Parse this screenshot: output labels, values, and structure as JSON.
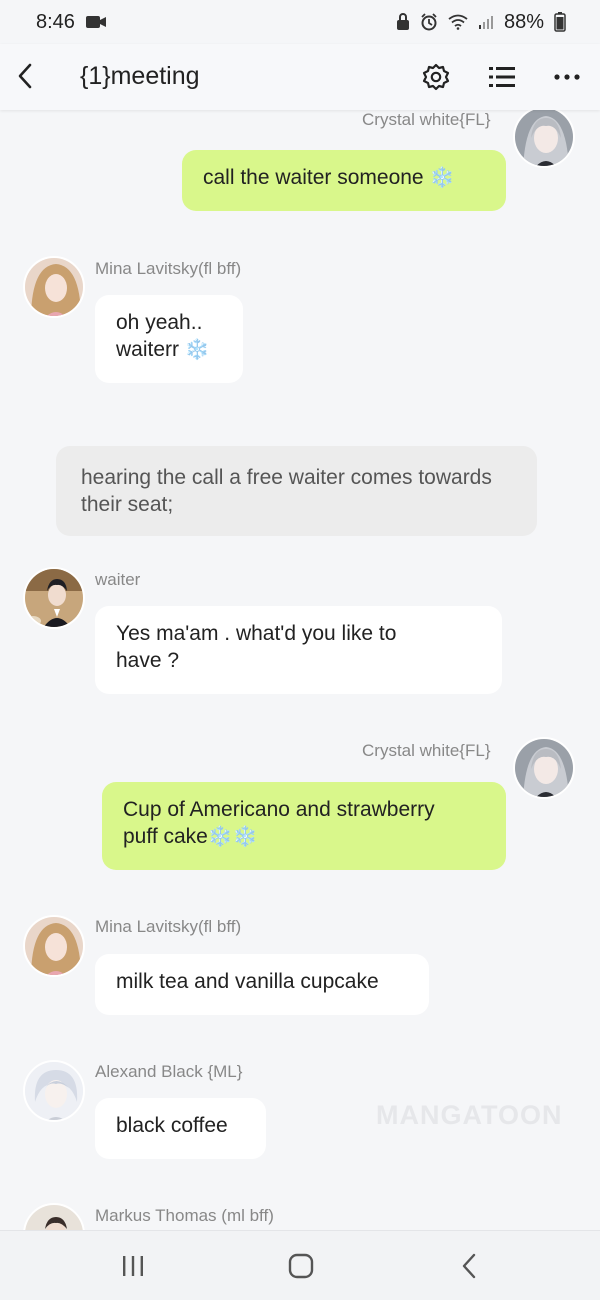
{
  "status_bar": {
    "time": "8:46",
    "battery": "88%",
    "icons": [
      "video-icon",
      "lock-icon",
      "alarm-icon",
      "wifi-icon",
      "signal-icon",
      "battery-icon"
    ]
  },
  "header": {
    "title": "{1}meeting",
    "icons": [
      "back-icon",
      "gear-icon",
      "list-icon",
      "more-icon"
    ]
  },
  "messages": [
    {
      "sender": "Crystal white{FL}",
      "side": "right",
      "text": "call the waiter someone",
      "emoji": "❄️",
      "color": "green"
    },
    {
      "sender": "Mina Lavitsky(fl bff)",
      "side": "left",
      "text_lines": [
        "oh yeah..",
        "waiterr"
      ],
      "emoji": "❄️",
      "color": "white"
    },
    {
      "narration": "hearing the call a free waiter comes towards their seat;"
    },
    {
      "sender": "waiter",
      "side": "left",
      "text_lines": [
        "Yes ma'am . what'd you like to",
        "have ?"
      ],
      "color": "white"
    },
    {
      "sender": "Crystal white{FL}",
      "side": "right",
      "text_lines": [
        "Cup of Americano and strawberry",
        "puff cake"
      ],
      "emoji": "❄️❄️",
      "color": "green"
    },
    {
      "sender": "Mina Lavitsky(fl bff)",
      "side": "left",
      "text": "milk tea and vanilla cupcake",
      "color": "white"
    },
    {
      "sender": "Alexand Black {ML}",
      "side": "left",
      "text": "black coffee",
      "color": "white"
    },
    {
      "sender": "Markus Thomas  (ml bff)",
      "side": "left"
    }
  ],
  "watermark": "MANGATOON",
  "nav_bar": {
    "icons": [
      "recent-apps-icon",
      "home-icon",
      "back-nav-icon"
    ]
  },
  "colors": {
    "green_bubble": "#d9f78b",
    "white_bubble": "#ffffff",
    "narration": "#ececec",
    "background": "#f5f6f8",
    "snow": "#7cc7ee"
  }
}
